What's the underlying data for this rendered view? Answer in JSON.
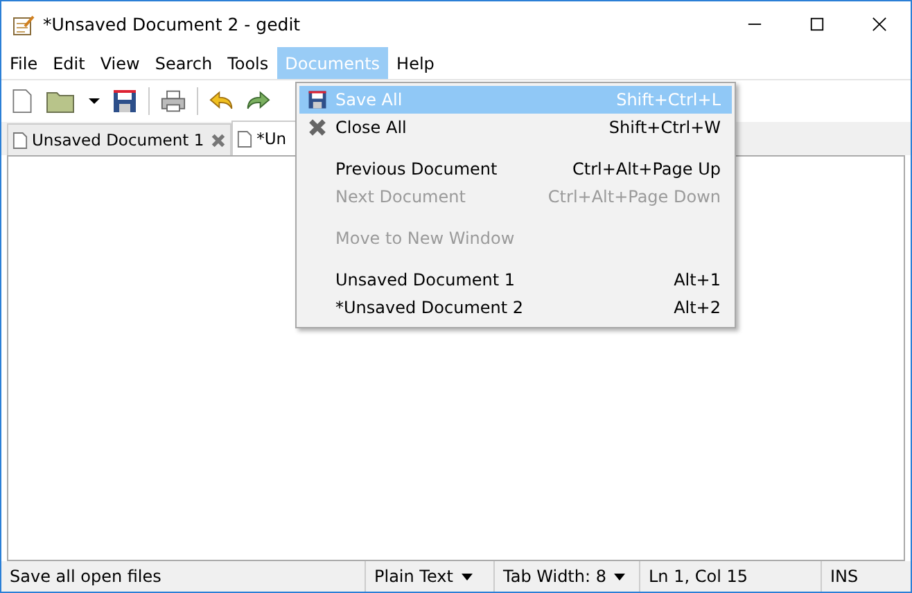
{
  "window": {
    "title": "*Unsaved Document 2 - gedit"
  },
  "menubar": [
    {
      "label": "File",
      "selected": false
    },
    {
      "label": "Edit",
      "selected": false
    },
    {
      "label": "View",
      "selected": false
    },
    {
      "label": "Search",
      "selected": false
    },
    {
      "label": "Tools",
      "selected": false
    },
    {
      "label": "Documents",
      "selected": true
    },
    {
      "label": "Help",
      "selected": false
    }
  ],
  "toolbar": [
    {
      "kind": "new"
    },
    {
      "kind": "open"
    },
    {
      "kind": "dropdown"
    },
    {
      "kind": "save"
    },
    {
      "kind": "sep"
    },
    {
      "kind": "print"
    },
    {
      "kind": "sep"
    },
    {
      "kind": "undo"
    },
    {
      "kind": "redo"
    }
  ],
  "tabs": [
    {
      "label": "Unsaved Document 1",
      "selected": false,
      "closable": true
    },
    {
      "label": "*Un",
      "selected": true,
      "closable": false
    }
  ],
  "menu": [
    {
      "kind": "save",
      "label": "Save All",
      "shortcut": "Shift+Ctrl+L",
      "selected": true,
      "disabled": false
    },
    {
      "kind": "close",
      "label": "Close All",
      "shortcut": "Shift+Ctrl+W",
      "selected": false,
      "disabled": false
    },
    {
      "kind": "sep"
    },
    {
      "kind": "item",
      "label": "Previous Document",
      "shortcut": "Ctrl+Alt+Page Up",
      "selected": false,
      "disabled": false
    },
    {
      "kind": "item",
      "label": "Next Document",
      "shortcut": "Ctrl+Alt+Page Down",
      "selected": false,
      "disabled": true
    },
    {
      "kind": "sep"
    },
    {
      "kind": "item",
      "label": "Move to New Window",
      "selected": false,
      "disabled": true
    },
    {
      "kind": "sep"
    },
    {
      "kind": "item",
      "label": "Unsaved Document 1",
      "shortcut": "Alt+1",
      "selected": false,
      "disabled": false
    },
    {
      "kind": "item",
      "label": "*Unsaved Document 2",
      "shortcut": "Alt+2",
      "selected": false,
      "disabled": false
    }
  ],
  "status_bar": {
    "message": "Save all open files",
    "language": "Plain Text",
    "tab_width": "Tab Width:  8",
    "position": "Ln 1, Col 15",
    "mode": "INS"
  }
}
